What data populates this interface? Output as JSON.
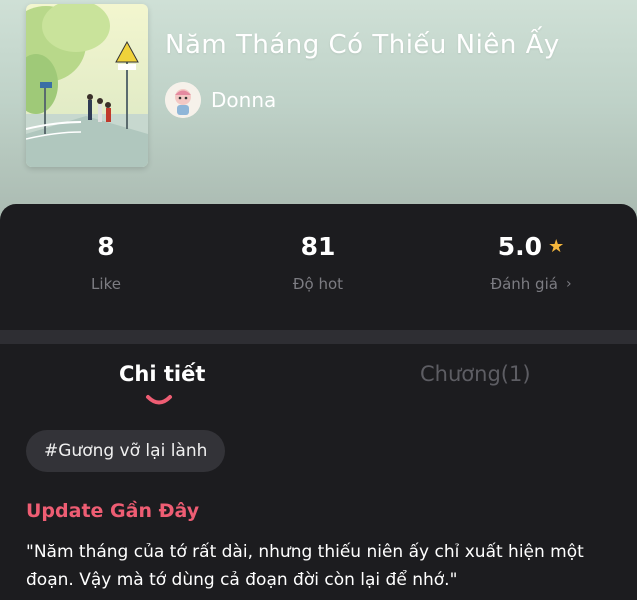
{
  "book": {
    "title": "Năm Tháng Có Thiếu Niên Ấy",
    "author": "Donna"
  },
  "stats": [
    {
      "value": "8",
      "label": "Like"
    },
    {
      "value": "81",
      "label": "Độ hot"
    },
    {
      "value": "5.0",
      "label": "Đánh giá"
    }
  ],
  "tabs": {
    "detail": "Chi tiết",
    "chapters": "Chương(1)"
  },
  "tag": "#Gương vỡ lại lành",
  "update": {
    "heading": "Update Gần Đây",
    "text": "\"Năm tháng của tớ rất dài, nhưng thiếu niên ấy chỉ xuất hiện một đoạn. Vậy mà tớ dùng cả đoạn đời còn lại để nhớ.\""
  },
  "colors": {
    "accent": "#ee5d73",
    "star": "#f6b73c",
    "panel": "#1c1c1f"
  },
  "icons": [
    "star-icon",
    "chevron-right-icon",
    "smile-indicator-icon"
  ]
}
